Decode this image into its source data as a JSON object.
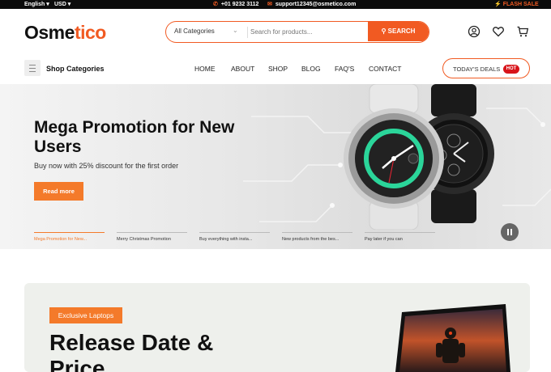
{
  "topbar": {
    "language": "English ▾",
    "currency": "USD ▾",
    "phone": "+01 9232 3112",
    "email": "support12345@osmetico.com",
    "flash_sale": "FLASH SALE"
  },
  "header": {
    "logo_part1": "Osme",
    "logo_part2": "tico",
    "search": {
      "category": "All Categories",
      "placeholder": "Search for products...",
      "button": "SEARCH"
    },
    "icons": [
      "user-icon",
      "heart-icon",
      "cart-icon"
    ]
  },
  "nav": {
    "categories_label": "Shop Categories",
    "links": [
      "HOME",
      "ABOUT",
      "SHOP",
      "BLOG",
      "FAQ'S",
      "CONTACT"
    ],
    "deals_label": "TODAY'S DEALS",
    "deals_badge": "HOT"
  },
  "hero": {
    "title": "Mega Promotion for New Users",
    "subtitle": "Buy now with 25% discount for the first order",
    "button": "Read more",
    "slides": [
      "Mega Promotion for New...",
      "Merry Christmas Promotion",
      "Buy everything with insta...",
      "New products from the bes...",
      "Pay later if you can"
    ],
    "active_slide": 0
  },
  "promo2": {
    "tag": "Exclusive Laptops",
    "title_line1": "Release Date &",
    "title_line2": "Price"
  },
  "colors": {
    "accent": "#f15a22",
    "hot": "#d8141a"
  }
}
